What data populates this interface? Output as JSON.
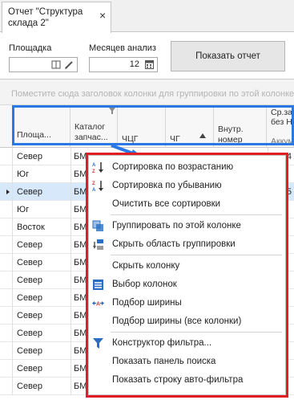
{
  "tab": {
    "title": "Отчет \"Структура склада 2\"",
    "close": "×"
  },
  "params": {
    "site_label": "Площадка",
    "site_value": "",
    "months_label": "Месяцев анализ",
    "months_value": "12",
    "show_report": "Показать отчет"
  },
  "grid": {
    "group_hint": "Поместите сюда заголовок колонки для группировки по этой колонке",
    "columns": [
      {
        "label": "Площа..."
      },
      {
        "label": "Каталог запчас..."
      },
      {
        "label": "ЧЦГ"
      },
      {
        "label": "ЧГ"
      },
      {
        "label": "Внутр. номер"
      },
      {
        "label": "Ср.зак ц. без НДС"
      },
      {
        "label": "Аккум. кол."
      }
    ],
    "rows": [
      {
        "site": "Север",
        "cat": "БМ",
        "end": "4"
      },
      {
        "site": "Юг",
        "cat": "БМ",
        "end": ""
      },
      {
        "site": "Север",
        "cat": "БМ",
        "end": "5",
        "selected": true
      },
      {
        "site": "Юг",
        "cat": "БМ",
        "end": ""
      },
      {
        "site": "Восток",
        "cat": "БМ",
        "end": ""
      },
      {
        "site": "Север",
        "cat": "БМ",
        "end": ""
      },
      {
        "site": "Север",
        "cat": "БМ",
        "end": ""
      },
      {
        "site": "Север",
        "cat": "БМ",
        "end": ""
      },
      {
        "site": "Север",
        "cat": "БМ",
        "end": ""
      },
      {
        "site": "Север",
        "cat": "БМ",
        "end": ""
      },
      {
        "site": "Север",
        "cat": "БМ",
        "end": ""
      },
      {
        "site": "Север",
        "cat": "БМ",
        "end": ""
      },
      {
        "site": "Север",
        "cat": "БМ",
        "end": ""
      },
      {
        "site": "Север",
        "cat": "БМ",
        "end": ""
      }
    ]
  },
  "menu": {
    "items": [
      {
        "label": "Сортировка по возрастанию",
        "icon": "sort-ascending-icon"
      },
      {
        "label": "Сортировка по убыванию",
        "icon": "sort-descending-icon"
      },
      {
        "label": "Очистить все сортировки",
        "icon": ""
      },
      {
        "label": "Группировать по этой колонке",
        "icon": "group-by-column-icon"
      },
      {
        "label": "Скрыть область группировки",
        "icon": "group-panel-icon"
      },
      {
        "label": "Скрыть колонку",
        "icon": ""
      },
      {
        "label": "Выбор колонок",
        "icon": "column-chooser-icon"
      },
      {
        "label": "Подбор ширины",
        "icon": "best-fit-icon"
      },
      {
        "label": "Подбор ширины (все колонки)",
        "icon": ""
      },
      {
        "label": "Конструктор фильтра...",
        "icon": "filter-icon"
      },
      {
        "label": "Показать панель поиска",
        "icon": ""
      },
      {
        "label": "Показать строку авто-фильтра",
        "icon": ""
      }
    ]
  },
  "colors": {
    "highlight_blue": "#2b78e4",
    "highlight_red": "#e21d24",
    "selected_row": "#d7e8fb"
  }
}
